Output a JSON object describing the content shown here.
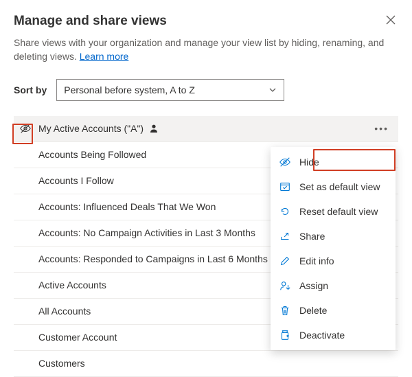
{
  "header": {
    "title": "Manage and share views",
    "subtitle_pre": "Share views with your organization and manage your view list by hiding, renaming, and deleting views. ",
    "learn_more": "Learn more"
  },
  "sort": {
    "label": "Sort by",
    "selected": "Personal before system, A to Z"
  },
  "views": [
    {
      "name": "My Active Accounts (\"A\")",
      "personal": true,
      "selected": true
    },
    {
      "name": "Accounts Being Followed"
    },
    {
      "name": "Accounts I Follow"
    },
    {
      "name": "Accounts: Influenced Deals That We Won"
    },
    {
      "name": "Accounts: No Campaign Activities in Last 3 Months"
    },
    {
      "name": "Accounts: Responded to Campaigns in Last 6 Months"
    },
    {
      "name": "Active Accounts"
    },
    {
      "name": "All Accounts"
    },
    {
      "name": "Customer Account"
    },
    {
      "name": "Customers"
    }
  ],
  "menu": {
    "hide": "Hide",
    "set_default": "Set as default view",
    "reset_default": "Reset default view",
    "share": "Share",
    "edit_info": "Edit info",
    "assign": "Assign",
    "delete": "Delete",
    "deactivate": "Deactivate"
  }
}
